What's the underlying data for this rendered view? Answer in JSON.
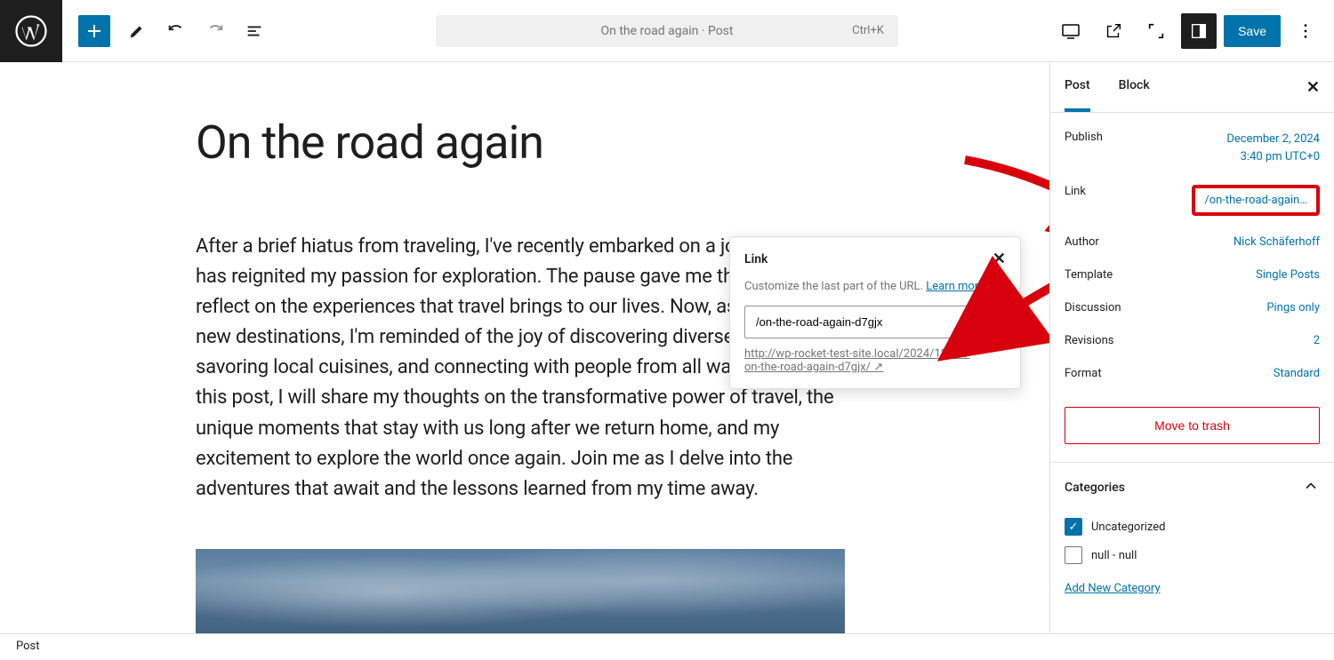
{
  "topbar": {
    "doc_title": "On the road again · Post",
    "shortcut": "Ctrl+K",
    "save_label": "Save"
  },
  "post": {
    "title": "On the road again",
    "body": "After a brief hiatus from traveling, I've recently embarked on a journey that has reignited my passion for exploration. The pause gave me the chance to reflect on the experiences that travel brings to our lives. Now, as I set foot in new destinations, I'm reminded of the joy of discovering diverse cultures, savoring local cuisines, and connecting with people from all walks of life. In this post, I will share my thoughts on the transformative power of travel, the unique moments that stay with us long after we return home, and my excitement to explore the world once again. Join me as I delve into the adventures that await and the lessons learned from my time away."
  },
  "link_popup": {
    "title": "Link",
    "desc_prefix": "Customize the last part of the URL. ",
    "learn_more": "Learn more. ↗",
    "slug_value": "/on-the-road-again-d7gjx",
    "url_line1": "http://wp-rocket-test-site.local/2024/12/02/",
    "url_line2": "on-the-road-again-d7gjx/",
    "url_arrow": "↗"
  },
  "sidebar": {
    "tabs": {
      "post": "Post",
      "block": "Block"
    },
    "publish": {
      "label": "Publish",
      "date": "December 2, 2024",
      "time": "3:40 pm UTC+0"
    },
    "link": {
      "label": "Link",
      "value": "/on-the-road-again…"
    },
    "author": {
      "label": "Author",
      "value": "Nick Schäferhoff"
    },
    "template": {
      "label": "Template",
      "value": "Single Posts"
    },
    "discussion": {
      "label": "Discussion",
      "value": "Pings only"
    },
    "revisions": {
      "label": "Revisions",
      "value": "2"
    },
    "format": {
      "label": "Format",
      "value": "Standard"
    },
    "trash": "Move to trash",
    "categories_header": "Categories",
    "cat1": "Uncategorized",
    "cat2": "null - null",
    "add_category": "Add New Category"
  },
  "footer": {
    "breadcrumb": "Post"
  }
}
